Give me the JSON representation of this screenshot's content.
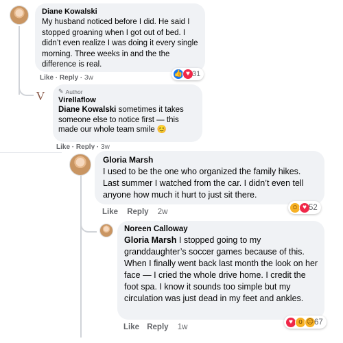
{
  "comments": [
    {
      "author": "Diane Kowalski",
      "text": "My husband noticed before I did. He said I stopped groaning when I got out of bed. I didn’t even realize I was doing it every single morning. Three weeks in and the the difference is real.",
      "like_label": "Like",
      "reply_label": "Reply",
      "time": "3w",
      "reaction_icons": [
        "like-icon",
        "love-icon"
      ],
      "reaction_count": "31"
    },
    {
      "badge": "Author",
      "author": "Virellaflow",
      "logo_letter": "V",
      "mention": "Diane Kowalski",
      "text": " sometimes it takes someone else to notice first — this made our whole team smile 😊",
      "like_label": "Like",
      "reply_label": "Reply",
      "time": "3w"
    },
    {
      "author": "Gloria Marsh",
      "text": "I used to be the one who organized the family hikes. Last summer I watched from the car. I didn’t even tell anyone how much it hurt to just sit there.",
      "like_label": "Like",
      "reply_label": "Reply",
      "time": "2w",
      "reaction_icons": [
        "care-icon",
        "love-icon"
      ],
      "reaction_count": "52"
    },
    {
      "author": "Noreen Calloway",
      "mention": "Gloria Marsh",
      "text": " I stopped going to my granddaughter’s soccer games because of this. When I finally went back last month the look on her face — I cried the whole drive home. I credit the foot spa. I know it sounds too simple but my circulation was just dead in my feet and ankles.",
      "like_label": "Like",
      "reply_label": "Reply",
      "time": "1w",
      "reaction_icons": [
        "love-icon",
        "wow-icon",
        "sad-icon"
      ],
      "reaction_count": "67"
    }
  ],
  "colors": {
    "bubble": "#f0f2f5",
    "meta_text": "#65676b",
    "like_blue": "#1877f2",
    "love_red": "#f02849",
    "emoji_yellow": "#f7b125"
  }
}
